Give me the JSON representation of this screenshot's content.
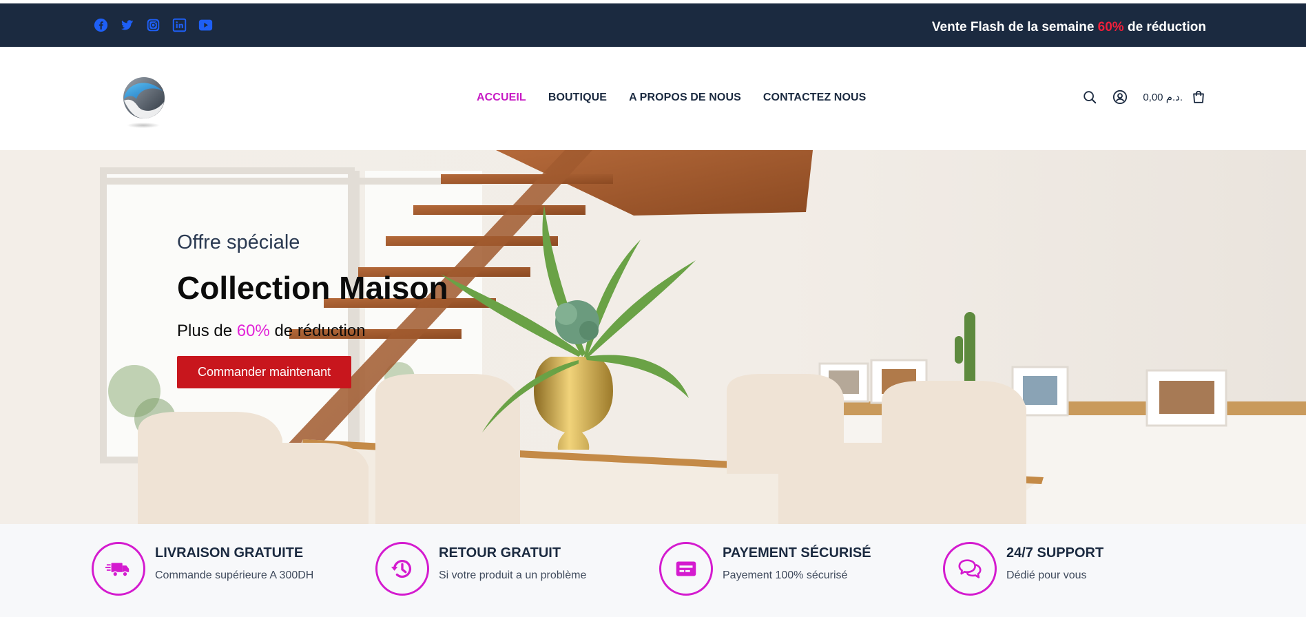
{
  "topbar": {
    "social_icons": [
      "facebook-icon",
      "twitter-icon",
      "instagram-icon",
      "linkedin-icon",
      "youtube-icon"
    ],
    "flash_prefix": "Vente Flash de la semaine",
    "flash_pct": "60%",
    "flash_suffix": "de réduction",
    "colors": {
      "background": "#1b2a40",
      "social": "#1e5ff5",
      "pct": "#f01f3a"
    }
  },
  "header": {
    "nav": [
      {
        "label": "ACCUEIL",
        "active": true
      },
      {
        "label": "BOUTIQUE",
        "active": false
      },
      {
        "label": "A PROPOS DE NOUS",
        "active": false
      },
      {
        "label": "CONTACTEZ NOUS",
        "active": false
      }
    ],
    "icons": [
      "search-icon",
      "account-icon",
      "cart-icon"
    ],
    "cart_total": "0,00 د.م.",
    "colors": {
      "active_nav": "#c71bc4",
      "text": "#1b2a40"
    }
  },
  "hero": {
    "offer": "Offre spéciale",
    "title": "Collection Maison",
    "discount_prefix": "Plus de",
    "discount_pct": "60%",
    "discount_suffix": "de réduction",
    "cta": "Commander maintenant",
    "colors": {
      "cta": "#c8161d",
      "pct": "#e124d7"
    }
  },
  "features": [
    {
      "icon": "truck-icon",
      "title": "LIVRAISON GRATUITE",
      "subtitle": "Commande supérieure A 300DH"
    },
    {
      "icon": "history-icon",
      "title": "RETOUR GRATUIT",
      "subtitle": "Si votre produit a un problème"
    },
    {
      "icon": "credit-card-icon",
      "title": "PAYEMENT SÉCURISÉ",
      "subtitle": "Payement 100% sécurisé"
    },
    {
      "icon": "chat-icon",
      "title": "24/7 SUPPORT",
      "subtitle": "Dédié pour vous"
    }
  ],
  "accent_color": "#d41bcf"
}
